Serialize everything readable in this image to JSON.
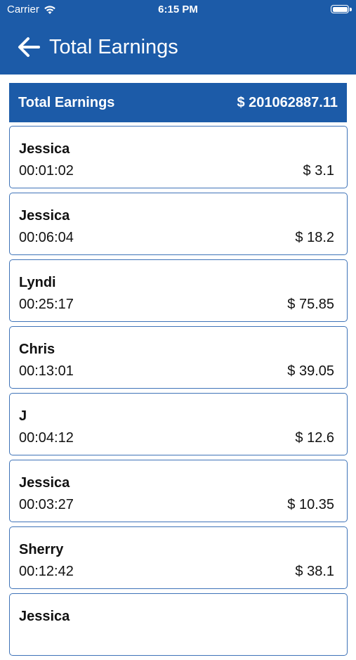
{
  "status_bar": {
    "carrier": "Carrier",
    "time": "6:15 PM",
    "wifi_icon": "wifi-icon",
    "battery_icon": "battery-icon"
  },
  "nav": {
    "back_icon": "arrow-left-icon",
    "title": "Total Earnings"
  },
  "summary": {
    "label": "Total Earnings",
    "amount": "$ 201062887.11"
  },
  "colors": {
    "primary": "#1c5ba8",
    "card_border": "#3f73b8"
  },
  "earnings": [
    {
      "name": "Jessica",
      "duration": "00:01:02",
      "amount": "$ 3.1"
    },
    {
      "name": "Jessica",
      "duration": "00:06:04",
      "amount": "$ 18.2"
    },
    {
      "name": "Lyndi",
      "duration": "00:25:17",
      "amount": "$ 75.85"
    },
    {
      "name": "Chris",
      "duration": "00:13:01",
      "amount": "$ 39.05"
    },
    {
      "name": "J",
      "duration": "00:04:12",
      "amount": "$ 12.6"
    },
    {
      "name": "Jessica",
      "duration": "00:03:27",
      "amount": "$ 10.35"
    },
    {
      "name": "Sherry",
      "duration": "00:12:42",
      "amount": "$ 38.1"
    },
    {
      "name": "Jessica",
      "duration": "",
      "amount": ""
    }
  ]
}
